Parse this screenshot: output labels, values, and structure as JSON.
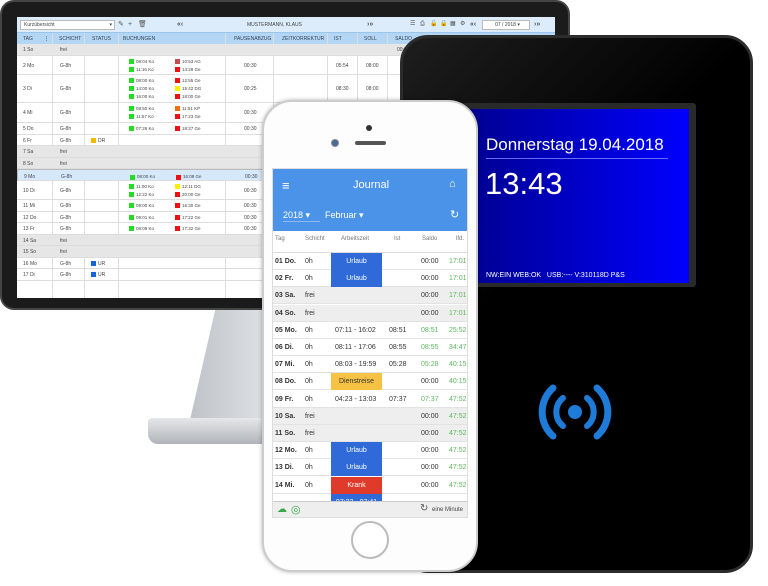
{
  "desktop": {
    "view_select": "Kurzübersicht",
    "employee": "MUSTERMANN, KLAUS",
    "month_select": "07 / 2018",
    "icons": [
      "pencil-icon",
      "plus-icon",
      "trash-icon",
      "first-page-icon",
      "prev-icon",
      "next-icon",
      "last-page-icon",
      "list-icon",
      "print-icon",
      "unlock-icon",
      "lock-icon",
      "calculator-icon",
      "settings-icon"
    ],
    "columns": [
      "TAG",
      "SCHICHT",
      "STATUS",
      "BUCHUNGEN",
      "PAUSENABZUG",
      "ZEITKORREKTUR",
      "IST",
      "SOLL",
      "SALDO"
    ],
    "rows": [
      {
        "tag": "1 So",
        "schicht": "frei",
        "type": "grey",
        "saldo": "00:00",
        "bookings": []
      },
      {
        "tag": "2 Mo",
        "schicht": "G-8h",
        "pause": "00:30",
        "ist": "05:54",
        "soll": "08:00",
        "bookings": [
          [
            "08:04 Ko",
            "#22dd22"
          ],
          [
            "10:53 AG",
            "#c0504d"
          ],
          [
            "11:16 Ko",
            "#22dd22"
          ],
          [
            "14:28 Ge",
            "#ee1111"
          ]
        ]
      },
      {
        "tag": "3 Di",
        "schicht": "G-8h",
        "pause": "00:25",
        "ist": "08:30",
        "soll": "08:00",
        "bookings": [
          [
            "08:00 Ko",
            "#22dd22"
          ],
          [
            "12:55 Ge",
            "#ee1111"
          ],
          [
            "14:00 Ko",
            "#22dd22"
          ],
          [
            "15:42 DG",
            "#ffee00"
          ],
          [
            "16:00 Ko",
            "#22dd22"
          ],
          [
            "18:00 Ge",
            "#ee1111"
          ]
        ]
      },
      {
        "tag": "4 Mi",
        "schicht": "G-8h",
        "pause": "00:30",
        "ist": "07:57",
        "soll": "08:00",
        "bookings": [
          [
            "08:50 Ko",
            "#22dd22"
          ],
          [
            "11:51 KP",
            "#f07010"
          ],
          [
            "11:57 Ko",
            "#22dd22"
          ],
          [
            "17:23 Ge",
            "#ee1111"
          ]
        ]
      },
      {
        "tag": "5 Do",
        "schicht": "G-8h",
        "pause": "00:30",
        "bookings": [
          [
            "07:26 Ko",
            "#22dd22"
          ],
          [
            "18:27 Ge",
            "#ee1111"
          ]
        ]
      },
      {
        "tag": "6 Fr",
        "schicht": "G-8h",
        "status": "DR",
        "status_color": "#f5b800",
        "bookings": []
      },
      {
        "tag": "7 Sa",
        "schicht": "frei",
        "type": "grey",
        "bookings": []
      },
      {
        "tag": "8 So",
        "schicht": "frei",
        "type": "grey",
        "bookings": []
      },
      {
        "tag": "9 Mo",
        "schicht": "G-8h",
        "type": "sel",
        "pause": "00:30",
        "bookings": [
          [
            "08:00 Ko",
            "#22dd22"
          ],
          [
            "16:08 Ge",
            "#ee1111"
          ]
        ]
      },
      {
        "tag": "10 Di",
        "schicht": "G-8h",
        "pause": "00:30",
        "bookings": [
          [
            "11:00 Ko",
            "#22dd22"
          ],
          [
            "12:11 DG",
            "#ffee00"
          ],
          [
            "12:22 Ko",
            "#22dd22"
          ],
          [
            "20:00 Ge",
            "#ee1111"
          ]
        ]
      },
      {
        "tag": "11 Mi",
        "schicht": "G-8h",
        "pause": "00:30",
        "bookings": [
          [
            "09:00 Ko",
            "#22dd22"
          ],
          [
            "16:30 Ge",
            "#ee1111"
          ]
        ]
      },
      {
        "tag": "12 Do",
        "schicht": "G-8h",
        "pause": "00:30",
        "bookings": [
          [
            "09:01 Ko",
            "#22dd22"
          ],
          [
            "17:22 Ge",
            "#ee1111"
          ]
        ]
      },
      {
        "tag": "13 Fr",
        "schicht": "G-8h",
        "pause": "00:30",
        "bookings": [
          [
            "08:09 Ko",
            "#22dd22"
          ],
          [
            "17:32 Ge",
            "#ee1111"
          ]
        ]
      },
      {
        "tag": "14 Sa",
        "schicht": "frei",
        "type": "grey",
        "bookings": []
      },
      {
        "tag": "15 So",
        "schicht": "frei",
        "type": "grey",
        "bookings": []
      },
      {
        "tag": "16 Mo",
        "schicht": "G-8h",
        "status": "UR",
        "status_color": "#1565d8",
        "bookings": []
      },
      {
        "tag": "17 Di",
        "schicht": "G-8h",
        "status": "UR",
        "status_color": "#1565d8",
        "bookings": []
      }
    ]
  },
  "clock": {
    "date": "Donnerstag 19.04.2018",
    "time": "13:43",
    "status": "NW:EIN WEB:OK   USB:---- V:310118D P&S",
    "icon": "rfid-icon"
  },
  "phone": {
    "title": "Journal",
    "year": "2018",
    "month": "Februar",
    "columns": [
      "Tag",
      "Schicht",
      "Arbeitszeit",
      "Ist",
      "Saldo",
      "lfd."
    ],
    "rows": [
      {
        "tag": "01 Do.",
        "schicht": "0h",
        "band": "Urlaub",
        "band_color": "#2f6ad8",
        "saldo": "00:00",
        "lfd": "17:01"
      },
      {
        "tag": "02 Fr.",
        "schicht": "0h",
        "band": "Urlaub",
        "band_color": "#2f6ad8",
        "saldo": "00:00",
        "lfd": "17:01"
      },
      {
        "tag": "03 Sa.",
        "schicht": "frei",
        "grey": true,
        "saldo": "00:00",
        "lfd": "17:01"
      },
      {
        "tag": "04 So.",
        "schicht": "frei",
        "grey": true,
        "saldo": "00:00",
        "lfd": "17:01"
      },
      {
        "tag": "05 Mo.",
        "schicht": "0h",
        "az": "07:11 - 16:02",
        "ist": "08:51",
        "saldo": "08:51",
        "saldo_green": true,
        "lfd": "25:52"
      },
      {
        "tag": "06 Di.",
        "schicht": "0h",
        "az": "08:11 - 17:06",
        "ist": "08:55",
        "saldo": "08:55",
        "saldo_green": true,
        "lfd": "34:47"
      },
      {
        "tag": "07 Mi.",
        "schicht": "0h",
        "az": "08:03 - 19:59",
        "ist": "05:28",
        "saldo": "05:28",
        "saldo_green": true,
        "lfd": "40:15"
      },
      {
        "tag": "08 Do.",
        "schicht": "0h",
        "band": "Dienstreise",
        "band_color": "#f6c244",
        "band_text": "#333",
        "saldo": "00:00",
        "lfd": "40:15"
      },
      {
        "tag": "09 Fr.",
        "schicht": "0h",
        "az": "04:23 - 13:03",
        "ist": "07:37",
        "saldo": "07:37",
        "saldo_green": true,
        "lfd": "47:52"
      },
      {
        "tag": "10 Sa.",
        "schicht": "frei",
        "grey": true,
        "saldo": "00:00",
        "lfd": "47:52"
      },
      {
        "tag": "11 So.",
        "schicht": "frei",
        "grey": true,
        "saldo": "00:00",
        "lfd": "47:52"
      },
      {
        "tag": "12 Mo.",
        "schicht": "0h",
        "band": "Urlaub",
        "band_color": "#2f6ad8",
        "saldo": "00:00",
        "lfd": "47:52"
      },
      {
        "tag": "13 Di.",
        "schicht": "0h",
        "band": "Urlaub",
        "band_color": "#2f6ad8",
        "saldo": "00:00",
        "lfd": "47:52"
      },
      {
        "tag": "14 Mi.",
        "schicht": "0h",
        "band": "Krank",
        "band_color": "#e03a2a",
        "saldo": "00:00",
        "lfd": "47:52"
      },
      {
        "tag": "",
        "schicht": "",
        "band": "07:23 - 07:41",
        "band_color": "#2f6ad8",
        "saldo": "",
        "lfd": ""
      }
    ],
    "footer": {
      "refresh": "eine Minute"
    }
  }
}
